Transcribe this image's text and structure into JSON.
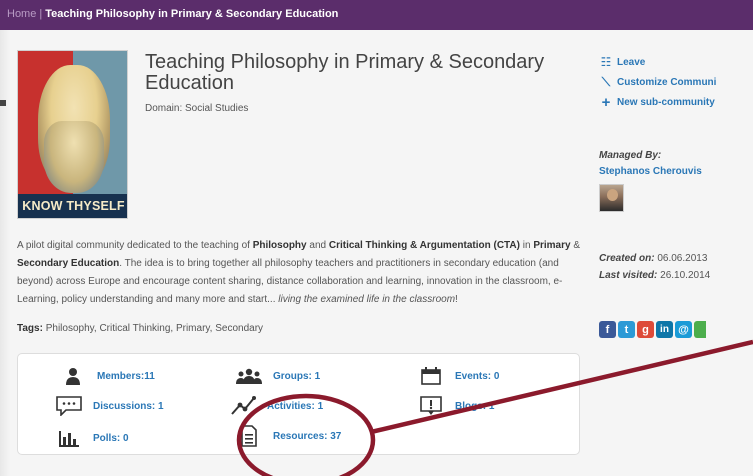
{
  "breadcrumb": {
    "home": "Home",
    "separator": "|",
    "current": "Teaching Philosophy in Primary & Secondary Education"
  },
  "community": {
    "title": "Teaching Philosophy in Primary & Secondary Education",
    "domain": "Domain: Social Studies",
    "poster_text": "KNOW THYSELF",
    "description": {
      "p1": "A pilot digital community dedicated to the teaching of ",
      "b1": "Philosophy",
      "p2": " and ",
      "b2": "Critical Thinking & Argumentation (CTA)",
      "p3": " in ",
      "b3": "Primary",
      "p4": " & ",
      "b4": "Secondary Education",
      "p5": ". The idea is to bring together all philosophy teachers and practitioners in secondary education (and beyond) across Europe and encourage content sharing, distance collaboration and learning, innovation in the classroom, e-Learning, policy understanding and many more and start... ",
      "i1": "living the examined life in the classroom",
      "p6": "!"
    },
    "tags_label": "Tags:",
    "tags": "Philosophy, Critical Thinking, Primary, Secondary"
  },
  "stats": {
    "members": "Members:11",
    "groups": "Groups: 1",
    "events": "Events: 0",
    "discussions": "Discussions: 1",
    "activities": "Activities: 1",
    "blogs": "Blogs: 1",
    "polls": "Polls: 0",
    "resources": "Resources: 37"
  },
  "sidebar": {
    "actions": {
      "leave": "Leave",
      "customize": "Customize Communi",
      "new_sub": "New sub-community"
    },
    "managed_by_label": "Managed By:",
    "manager_name": "Stephanos Cherouvis",
    "created_label": "Created on:",
    "created_value": "06.06.2013",
    "visited_label": "Last visited:",
    "visited_value": "26.10.2014",
    "share": {
      "facebook": "f",
      "twitter": "t",
      "google": "g",
      "linkedin": "in",
      "email": "@"
    }
  },
  "colors": {
    "topbar": "#5b2d6b",
    "link": "#2a77b6",
    "annotation": "#8b1a2c",
    "facebook": "#3b5998",
    "twitter": "#2c9ad6",
    "google": "#dd4b39",
    "linkedin": "#0e76a8",
    "email": "#1a9bd7",
    "other_share": "#4cae4c"
  }
}
